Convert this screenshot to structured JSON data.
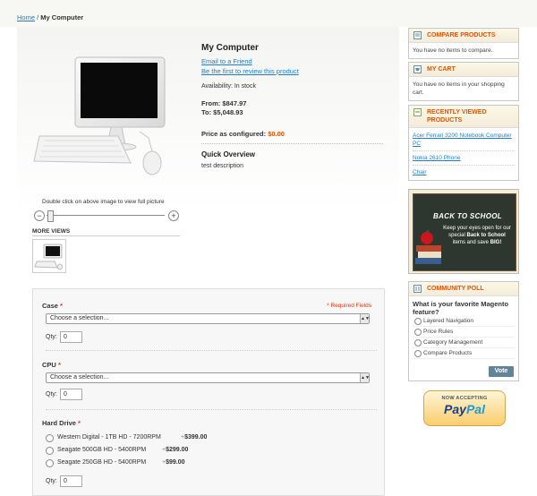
{
  "breadcrumb": {
    "home": "Home",
    "separator": " / ",
    "current": "My Computer"
  },
  "product": {
    "name": "My Computer",
    "email_link": "Email to a Friend",
    "review_link": "Be the first to review this product",
    "availability": "Availability: In stock",
    "price_from": "From: $847.97",
    "price_to": "To: $5,048.93",
    "price_configured_label": "Price as configured: ",
    "price_configured_value": "$0.00",
    "quick_overview_title": "Quick Overview",
    "description": "test description"
  },
  "image_viewer": {
    "hint": "Double click on above image to view full picture",
    "zoom_out": "−",
    "zoom_in": "+",
    "more_views": "MORE VIEWS"
  },
  "options": {
    "required_note": "* Required Fields",
    "qty_label": "Qty:",
    "case": {
      "label": "Case",
      "star": "*",
      "placeholder": "Choose a selection...",
      "qty": "0"
    },
    "cpu": {
      "label": "CPU",
      "star": "*",
      "placeholder": "Choose a selection...",
      "qty": "0"
    },
    "hard_drive": {
      "label": "Hard Drive",
      "star": "*",
      "choices": [
        {
          "name": "Western Digital - 1TB HD - 7200RPM",
          "plus": "+",
          "price": "$399.00"
        },
        {
          "name": "Seagate 500GB HD - 5400RPM",
          "plus": "+",
          "price": "$299.00"
        },
        {
          "name": "Seagate 250GB HD - 5400RPM",
          "plus": "+",
          "price": "$99.00"
        }
      ],
      "qty": "0"
    }
  },
  "sidebar": {
    "compare": {
      "title": "COMPARE PRODUCTS",
      "body": "You have no items to compare."
    },
    "cart": {
      "title": "MY CART",
      "body": "You have no items in your shopping cart."
    },
    "recently_viewed": {
      "title": "RECENTLY VIEWED PRODUCTS",
      "items": [
        "Acer Ferrari 3200 Notebook Computer PC",
        "Nokia 2610 Phone",
        "Chair"
      ]
    },
    "promo": {
      "title": "BACK TO SCHOOL",
      "line1": "Keep your eyes open for our special",
      "line2": "Back to School",
      "line3": "items and save",
      "line4": "BIG!"
    },
    "poll": {
      "title": "COMMUNITY POLL",
      "question": "What is your favorite Magento feature?",
      "options": [
        "Layered Navigation",
        "Price Rules",
        "Category Management",
        "Compare Products"
      ],
      "vote": "Vote"
    },
    "paypal": {
      "now": "NOW ACCEPTING",
      "pay": "Pay",
      "pal": "Pal"
    }
  },
  "colors": {
    "accent": "#e25203",
    "link": "#1e7ec8",
    "price": "#df5105",
    "vote": "#618499"
  }
}
